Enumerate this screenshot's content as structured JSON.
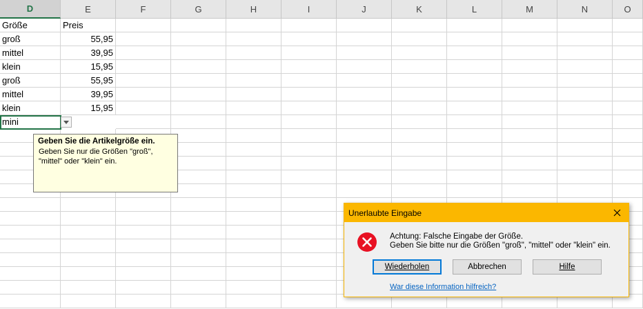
{
  "columns": [
    "D",
    "E",
    "F",
    "G",
    "H",
    "I",
    "J",
    "K",
    "L",
    "M",
    "N",
    "O"
  ],
  "active_column": "D",
  "rows": [
    {
      "d": "Größe",
      "e": ""
    },
    {
      "d": "groß",
      "e": "55,95"
    },
    {
      "d": "mittel",
      "e": "39,95"
    },
    {
      "d": "klein",
      "e": "15,95"
    },
    {
      "d": "groß",
      "e": "55,95"
    },
    {
      "d": "mittel",
      "e": "39,95"
    },
    {
      "d": "klein",
      "e": "15,95"
    },
    {
      "d": "mini",
      "e": ""
    }
  ],
  "header_e": "Preis",
  "active_cell_value": "mini",
  "input_message": {
    "title": "Geben Sie die Artikelgröße ein.",
    "body_line1": "Geben Sie nur die Größen \"groß\",",
    "body_line2": "\"mittel\" oder \"klein\" ein."
  },
  "dialog": {
    "title": "Unerlaubte Eingabe",
    "message_line1": "Achtung: Falsche Eingabe der Größe.",
    "message_line2": "Geben Sie bitte nur die Größen \"groß\", \"mittel\" oder \"klein\" ein.",
    "buttons": {
      "retry": "Wiederholen",
      "cancel": "Abbrechen",
      "help": "Hilfe"
    },
    "link": "War diese Information hilfreich?",
    "colors": {
      "title_bar": "#fbb700",
      "error": "#e81123"
    }
  }
}
